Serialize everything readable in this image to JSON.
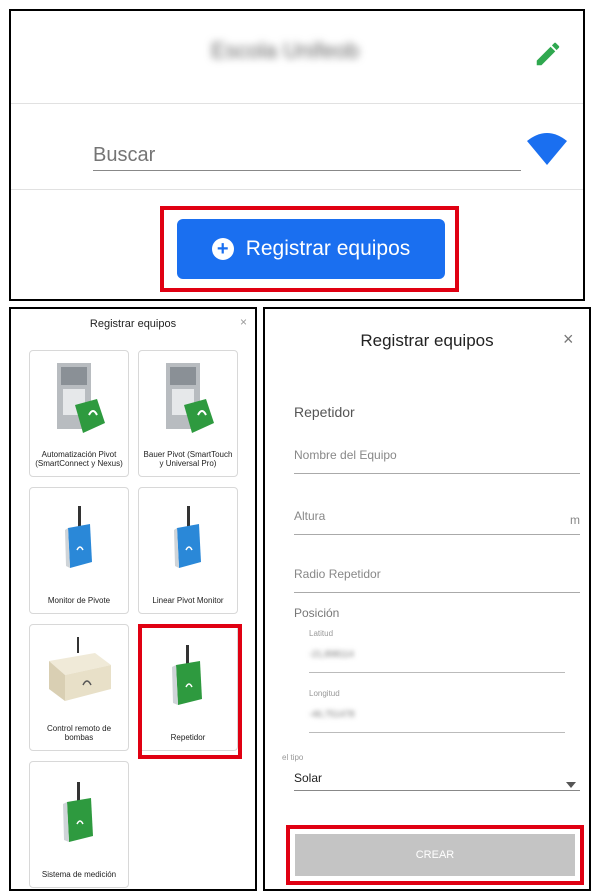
{
  "top": {
    "title": "Escola Unifeob",
    "search_placeholder": "Buscar",
    "register_button": "Registrar equipos",
    "icons": [
      "edit-pencil-icon",
      "wifi-icon",
      "plus-circle-icon"
    ],
    "accent": "#1a6ff0"
  },
  "modal_list": {
    "title": "Registrar equipos",
    "close": "×",
    "cards": [
      {
        "label": "Automatización Pivot (SmartConnect y Nexus)"
      },
      {
        "label": "Bauer Pivot (SmartTouch y Universal Pro)"
      },
      {
        "label": "Monitor de Pivote"
      },
      {
        "label": "Linear Pivot Monitor"
      },
      {
        "label": "Control remoto de bombas"
      },
      {
        "label": "Repetidor"
      },
      {
        "label": "Sistema de medición"
      }
    ]
  },
  "modal_form": {
    "title": "Registrar equipos",
    "close": "×",
    "section": "Repetidor",
    "name_placeholder": "Nombre del Equipo",
    "height_placeholder": "Altura",
    "height_unit": "m",
    "radius_placeholder": "Radio Repetidor",
    "position_label": "Posición",
    "lat_label": "Latitud",
    "lat_value": "-21,898114",
    "lng_label": "Longitud",
    "lng_value": "-46,751478",
    "type_label": "el tipo",
    "type_value": "Solar",
    "create_button": "CREAR"
  },
  "highlight_color": "#e00012"
}
